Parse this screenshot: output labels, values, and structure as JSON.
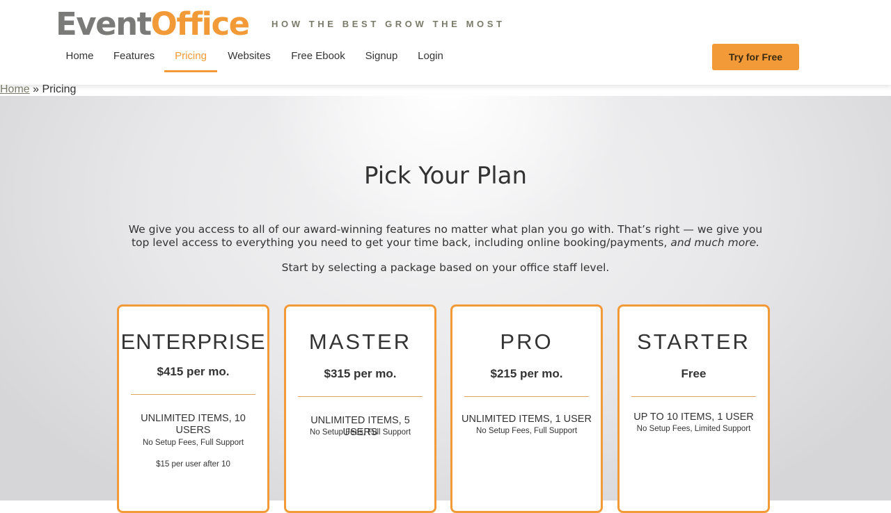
{
  "brand": {
    "logo_part1": "Event",
    "logo_part2": "Office",
    "tagline": "HOW THE BEST GROW THE MOST",
    "colors": {
      "accent": "#f39a38",
      "logo_gray": "#7a7a78",
      "text": "#333333"
    }
  },
  "nav": {
    "items": [
      {
        "label": "Home"
      },
      {
        "label": "Features"
      },
      {
        "label": "Pricing",
        "active": true
      },
      {
        "label": "Websites"
      },
      {
        "label": "Free Ebook"
      },
      {
        "label": "Signup"
      },
      {
        "label": "Login"
      }
    ],
    "cta_label": "Try for Free"
  },
  "breadcrumb": {
    "home": "Home",
    "separator": "»",
    "current": "Pricing"
  },
  "hero": {
    "title": "Pick Your Plan",
    "intro": "We give you access to all of our award-winning features no matter what plan you go with. That’s right — we give you top level access to everything you need to get your time back, including online booking/payments,",
    "intro_emphasis": "and much more.",
    "subtitle": "Start by selecting a package based on your office staff level."
  },
  "plans": [
    {
      "name": "ENTERPRISE",
      "price": "$415 per mo.",
      "items": "UNLIMITED ITEMS, 10 USERS",
      "fees": "No Setup Fees, Full Support",
      "extra": "$15 per user after 10"
    },
    {
      "name": "MASTER",
      "price": "$315 per mo.",
      "items": "UNLIMITED ITEMS, 5 USERS",
      "fees": "No Setup Fees, Full Support"
    },
    {
      "name": "PRO",
      "price": "$215 per mo.",
      "items": "UNLIMITED ITEMS, 1 USER",
      "fees": "No Setup Fees, Full Support"
    },
    {
      "name": "STARTER",
      "price": "Free",
      "items": "UP TO 10 ITEMS, 1 USER",
      "fees": "No Setup Fees, Limited Support"
    }
  ]
}
